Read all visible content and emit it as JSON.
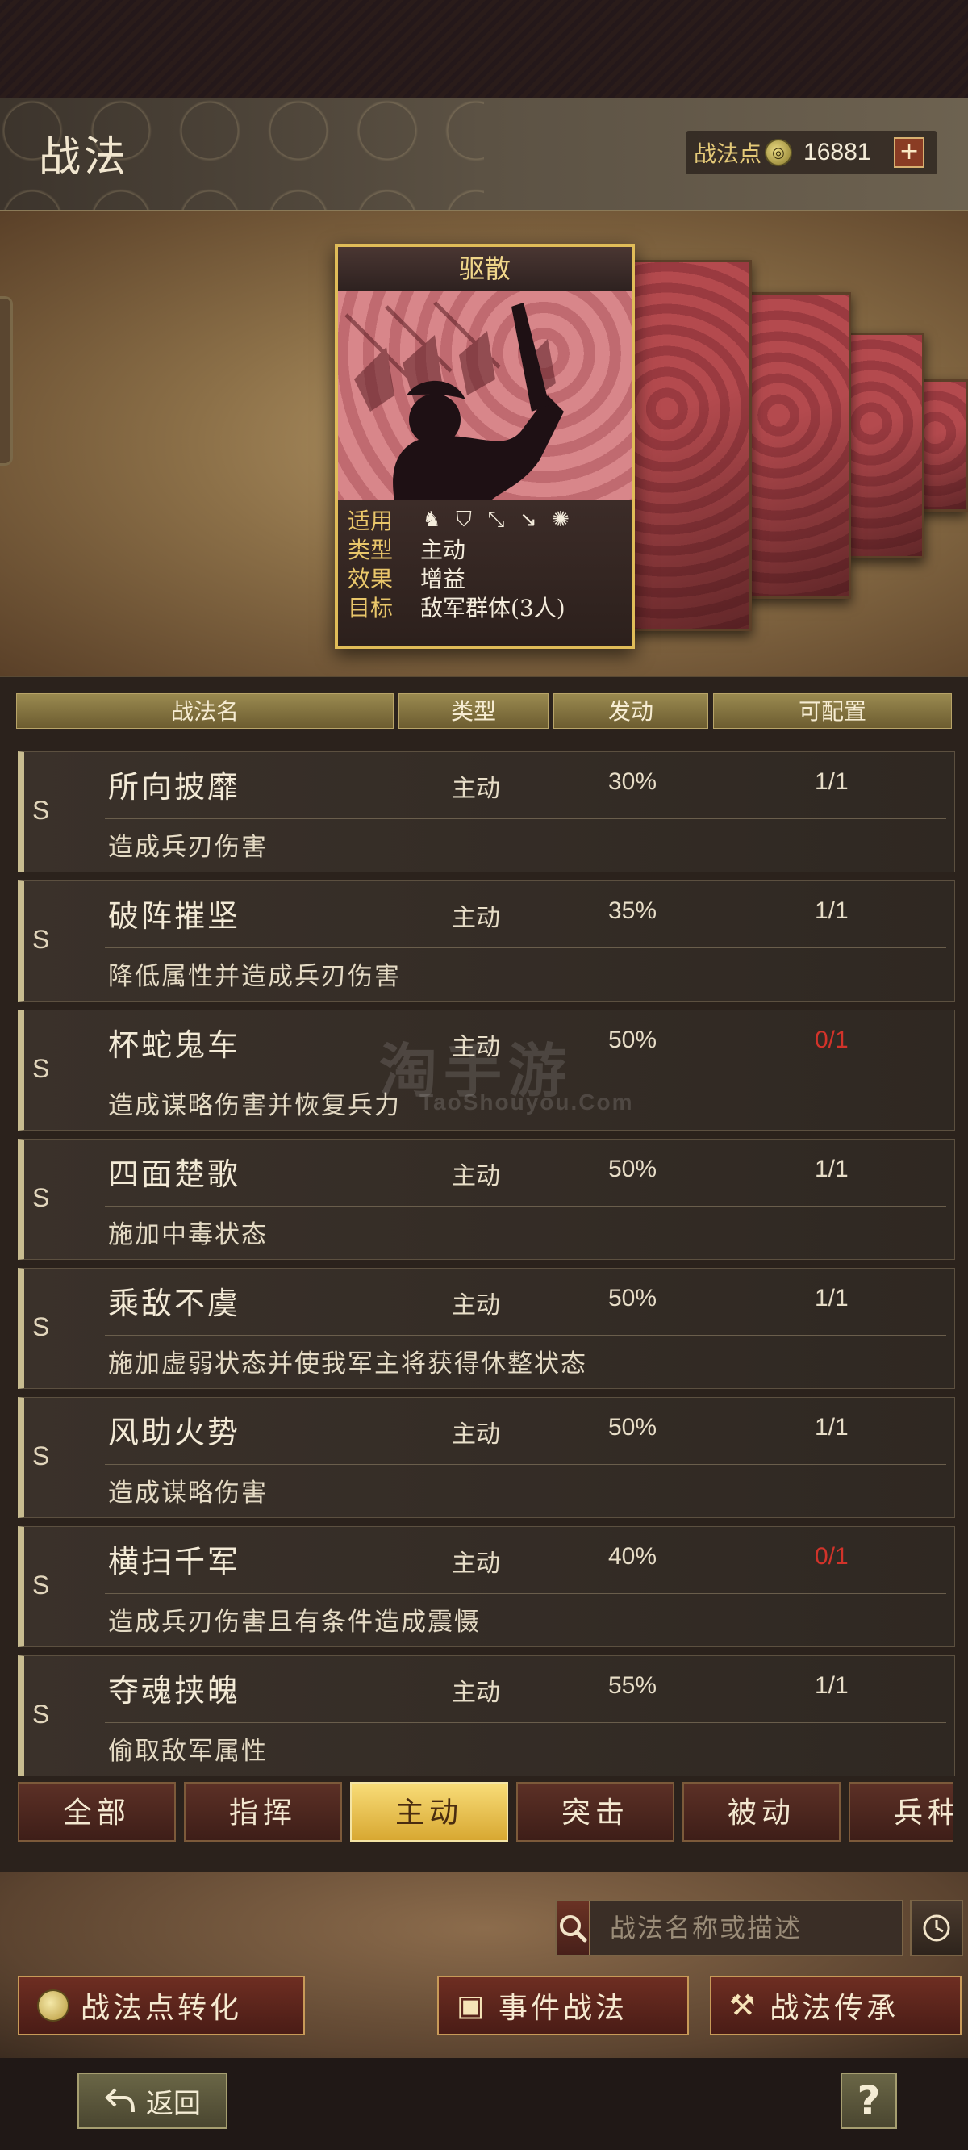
{
  "header": {
    "title": "战法",
    "points_label": "战法点",
    "points_value": "16881",
    "plus_symbol": "+"
  },
  "card": {
    "name": "驱散",
    "applicable_label": "适用",
    "type_label": "类型",
    "type_value": "主动",
    "effect_label": "效果",
    "effect_value": "增益",
    "target_label": "目标",
    "target_value": "敌军群体(3人)",
    "unit_icons": [
      "cavalry-icon",
      "shield-icon",
      "bow-icon",
      "spear-icon",
      "wheel-icon"
    ]
  },
  "columns": {
    "name": "战法名",
    "type": "类型",
    "trigger": "发动",
    "config": "可配置"
  },
  "tactics": [
    {
      "grade": "S",
      "name": "所向披靡",
      "type": "主动",
      "rate": "30%",
      "slots": "1/1",
      "desc": "造成兵刃伤害"
    },
    {
      "grade": "S",
      "name": "破阵摧坚",
      "type": "主动",
      "rate": "35%",
      "slots": "1/1",
      "desc": "降低属性并造成兵刃伤害"
    },
    {
      "grade": "S",
      "name": "杯蛇鬼车",
      "type": "主动",
      "rate": "50%",
      "slots": "0/1",
      "desc": "造成谋略伤害并恢复兵力"
    },
    {
      "grade": "S",
      "name": "四面楚歌",
      "type": "主动",
      "rate": "50%",
      "slots": "1/1",
      "desc": "施加中毒状态"
    },
    {
      "grade": "S",
      "name": "乘敌不虞",
      "type": "主动",
      "rate": "50%",
      "slots": "1/1",
      "desc": "施加虚弱状态并使我军主将获得休整状态"
    },
    {
      "grade": "S",
      "name": "风助火势",
      "type": "主动",
      "rate": "50%",
      "slots": "1/1",
      "desc": "造成谋略伤害"
    },
    {
      "grade": "S",
      "name": "横扫千军",
      "type": "主动",
      "rate": "40%",
      "slots": "0/1",
      "desc": "造成兵刃伤害且有条件造成震慑"
    },
    {
      "grade": "S",
      "name": "夺魂挟魄",
      "type": "主动",
      "rate": "55%",
      "slots": "1/1",
      "desc": "偷取敌军属性"
    }
  ],
  "watermark": {
    "main": "淘手游",
    "sub": "TaoShouyou.Com"
  },
  "filter_tabs": [
    "全部",
    "指挥",
    "主动",
    "突击",
    "被动",
    "兵种"
  ],
  "active_tab": "主动",
  "search": {
    "placeholder": "战法名称或描述"
  },
  "actions": {
    "convert": "战法点转化",
    "event": "事件战法",
    "inherit": "战法传承"
  },
  "footer": {
    "back": "返回",
    "help": "?"
  },
  "colors": {
    "accent_gold": "#e0bc58",
    "unavailable_red": "#d2332a",
    "active_tab": "#f0c850"
  }
}
